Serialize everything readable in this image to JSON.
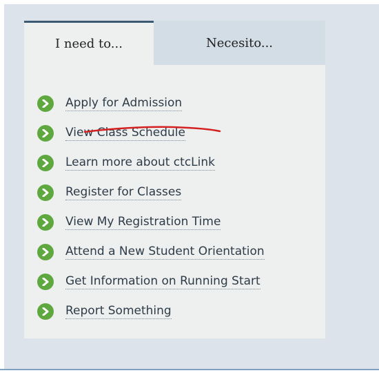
{
  "tabs": [
    {
      "label": "I need to..."
    },
    {
      "label": "Necesito..."
    }
  ],
  "links": [
    {
      "label": "Apply for Admission"
    },
    {
      "label": "View Class Schedule"
    },
    {
      "label": "Learn more about ctcLink"
    },
    {
      "label": "Register for Classes"
    },
    {
      "label": "View My Registration Time"
    },
    {
      "label": "Attend a New Student Orientation"
    },
    {
      "label": "Get Information on Running Start"
    },
    {
      "label": "Report Something"
    }
  ],
  "colors": {
    "accent_green": "#5fa83f",
    "annotation_red": "#d42020",
    "active_tab_border": "#3d5a73",
    "inactive_tab_bg": "#d2dde6"
  },
  "icons": {
    "link_bullet": "chevron-right-circle-icon"
  }
}
